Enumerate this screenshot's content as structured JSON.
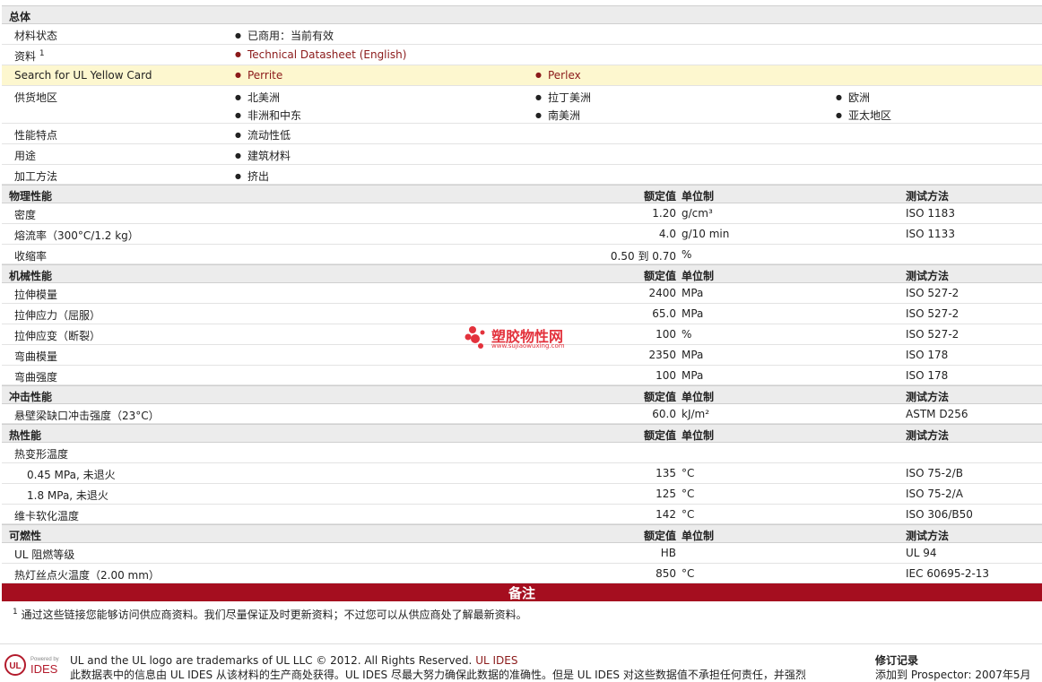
{
  "general": {
    "title": "总体",
    "status_label": "材料状态",
    "status_value": "已商用：当前有效",
    "docs_label": "资料",
    "docs_sup": "1",
    "docs_link": "Technical Datasheet (English)",
    "yellow_label": "Search for UL Yellow Card",
    "yellow_links": [
      "Perrite",
      "Perlex"
    ],
    "supply_label": "供货地区",
    "supply_regions": [
      "北美洲",
      "拉丁美洲",
      "欧洲",
      "非洲和中东",
      "南美洲",
      "亚太地区"
    ],
    "feature_label": "性能特点",
    "feature_value": "流动性低",
    "use_label": "用途",
    "use_value": "建筑材料",
    "process_label": "加工方法",
    "process_value": "挤出"
  },
  "headers": {
    "nominal": "额定值",
    "unit": "单位制",
    "method": "测试方法"
  },
  "sections": {
    "physical": {
      "title": "物理性能",
      "rows": [
        {
          "name": "密度",
          "value": "1.20",
          "unit": "g/cm³",
          "method": "ISO 1183"
        },
        {
          "name": "熔流率（300°C/1.2 kg）",
          "value": "4.0",
          "unit": "g/10 min",
          "method": "ISO 1133"
        },
        {
          "name": "收缩率",
          "value": "0.50 到  0.70",
          "unit": "%",
          "method": ""
        }
      ]
    },
    "mechanical": {
      "title": "机械性能",
      "rows": [
        {
          "name": "拉伸模量",
          "value": "2400",
          "unit": "MPa",
          "method": "ISO 527-2"
        },
        {
          "name": "拉伸应力（屈服）",
          "value": "65.0",
          "unit": "MPa",
          "method": "ISO 527-2"
        },
        {
          "name": "拉伸应变（断裂）",
          "value": "100",
          "unit": "%",
          "method": "ISO 527-2"
        },
        {
          "name": "弯曲模量",
          "value": "2350",
          "unit": "MPa",
          "method": "ISO 178"
        },
        {
          "name": "弯曲强度",
          "value": "100",
          "unit": "MPa",
          "method": "ISO 178"
        }
      ]
    },
    "impact": {
      "title": "冲击性能",
      "rows": [
        {
          "name": "悬壁梁缺口冲击强度（23°C）",
          "value": "60.0",
          "unit": "kJ/m²",
          "method": "ASTM D256"
        }
      ]
    },
    "thermal": {
      "title": "热性能",
      "rows": [
        {
          "name": "热变形温度",
          "value": "",
          "unit": "",
          "method": ""
        },
        {
          "name": "0.45 MPa, 未退火",
          "value": "135",
          "unit": "°C",
          "method": "ISO 75-2/B"
        },
        {
          "name": "1.8 MPa, 未退火",
          "value": "125",
          "unit": "°C",
          "method": "ISO 75-2/A"
        },
        {
          "name": "维卡软化温度",
          "value": "142",
          "unit": "°C",
          "method": "ISO 306/B50"
        }
      ]
    },
    "flammability": {
      "title": "可燃性",
      "rows": [
        {
          "name": "UL 阻燃等级",
          "value": "HB",
          "unit": "",
          "method": "UL 94"
        },
        {
          "name": "热灯丝点火温度（2.00 mm）",
          "value": "850",
          "unit": "°C",
          "method": "IEC 60695-2-13"
        }
      ]
    }
  },
  "notes": {
    "title": "备注",
    "sup": "1",
    "text": "通过这些链接您能够访问供应商资料。我们尽量保证及时更新资料；不过您可以从供应商处了解最新资料。"
  },
  "watermark": {
    "text": "塑胶物性网",
    "url": "www.sujiaowuxing.com"
  },
  "footer": {
    "logo_small": "Powered by",
    "logo_text": "IDES",
    "logo_mark": "UL",
    "line1": "UL and the UL logo are trademarks of UL LLC © 2012. All Rights Reserved.",
    "line1_link": "UL IDES",
    "line2": "此数据表中的信息由 UL IDES 从该材料的生产商处获得。UL IDES 尽最大努力确保此数据的准确性。但是 UL IDES 对这些数据值不承担任何责任，并强烈",
    "rev_title": "修订记录",
    "rev_line": "添加到 Prospector:    2007年5月"
  },
  "colors": {
    "accent": "#a50e1f",
    "link": "#8b1a1a",
    "highlight": "#fdf7cf"
  }
}
